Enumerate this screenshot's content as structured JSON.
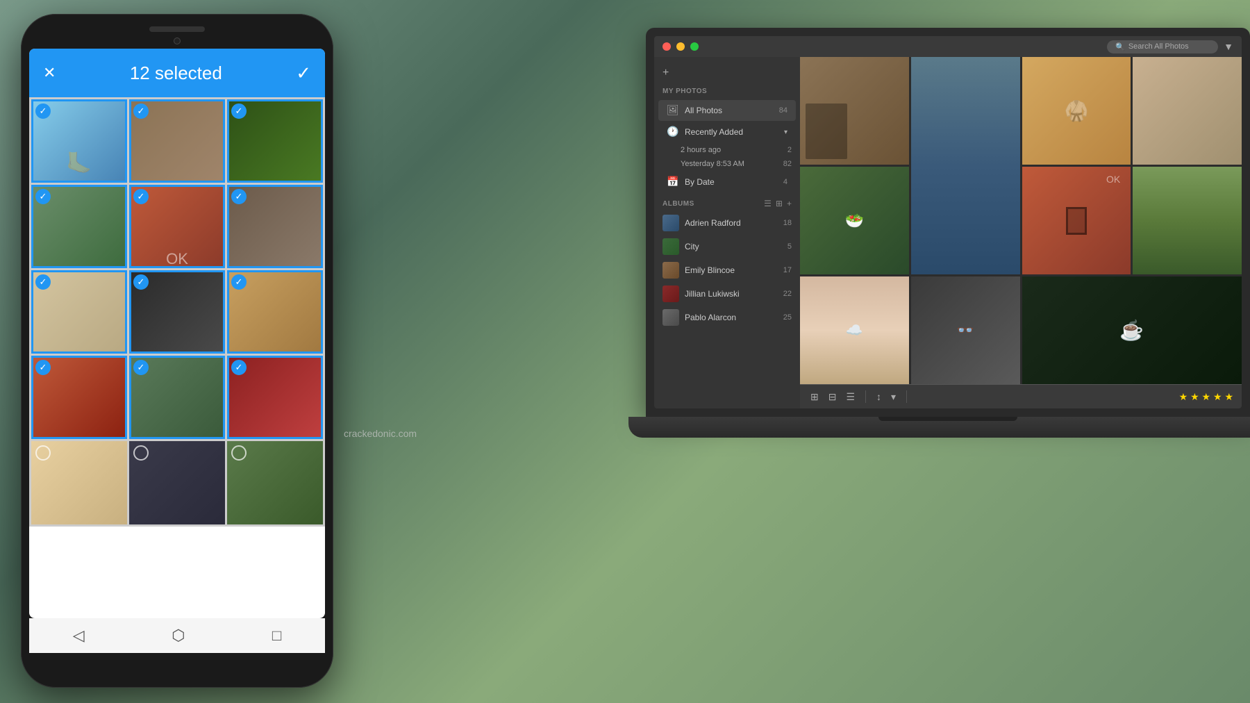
{
  "background": {
    "color": "#5a7a6a"
  },
  "phone": {
    "header": {
      "close_icon": "✕",
      "selected_count": "12 selected",
      "check_icon": "✓"
    },
    "photos": [
      {
        "id": 1,
        "selected": true,
        "color_class": "photo-color-1"
      },
      {
        "id": 2,
        "selected": true,
        "color_class": "photo-color-2"
      },
      {
        "id": 3,
        "selected": true,
        "color_class": "photo-color-3"
      },
      {
        "id": 4,
        "selected": true,
        "color_class": "photo-color-4"
      },
      {
        "id": 5,
        "selected": true,
        "color_class": "photo-color-5"
      },
      {
        "id": 6,
        "selected": true,
        "color_class": "photo-color-6"
      },
      {
        "id": 7,
        "selected": true,
        "color_class": "photo-color-7"
      },
      {
        "id": 8,
        "selected": true,
        "color_class": "photo-color-8"
      },
      {
        "id": 9,
        "selected": true,
        "color_class": "photo-color-9"
      },
      {
        "id": 10,
        "selected": true,
        "color_class": "photo-color-10"
      },
      {
        "id": 11,
        "selected": true,
        "color_class": "photo-color-11"
      },
      {
        "id": 12,
        "selected": true,
        "color_class": "photo-color-12"
      },
      {
        "id": 13,
        "selected": false,
        "color_class": "photo-color-13"
      },
      {
        "id": 14,
        "selected": false,
        "color_class": "photo-color-14"
      },
      {
        "id": 15,
        "selected": false,
        "color_class": "photo-color-15"
      }
    ],
    "nav": {
      "back_icon": "◁",
      "home_icon": "⬡",
      "recent_icon": "□"
    }
  },
  "laptop": {
    "titlebar": {
      "search_placeholder": "Search All Photos",
      "filter_icon": "▼"
    },
    "sidebar": {
      "add_label": "+",
      "my_photos_label": "MY PHOTOS",
      "all_photos_label": "All Photos",
      "all_photos_count": "84",
      "recently_added_label": "Recently Added",
      "recently_added_arrow": "▾",
      "sub_items": [
        {
          "label": "2 hours ago",
          "count": "2"
        },
        {
          "label": "Yesterday 8:53 AM",
          "count": "82"
        }
      ],
      "by_date_label": "By Date",
      "by_date_count": "4",
      "albums_label": "ALBUMS",
      "albums": [
        {
          "label": "Adrien Radford",
          "count": "18",
          "color": "thumb-blue"
        },
        {
          "label": "City",
          "count": "5",
          "color": "thumb-green"
        },
        {
          "label": "Emily Blincoe",
          "count": "17",
          "color": "thumb-warm"
        },
        {
          "label": "Jillian Lukiwski",
          "count": "22",
          "color": "thumb-red"
        },
        {
          "label": "Pablo Alarcon",
          "count": "25",
          "color": "thumb-gray"
        }
      ]
    },
    "toolbar": {
      "view_icons": [
        "⊞",
        "⊟",
        "☰",
        "▾"
      ],
      "stars": [
        "★",
        "★",
        "★",
        "★",
        "★"
      ],
      "star_count": 5
    }
  },
  "watermark": {
    "text": "crackedonic.com"
  }
}
